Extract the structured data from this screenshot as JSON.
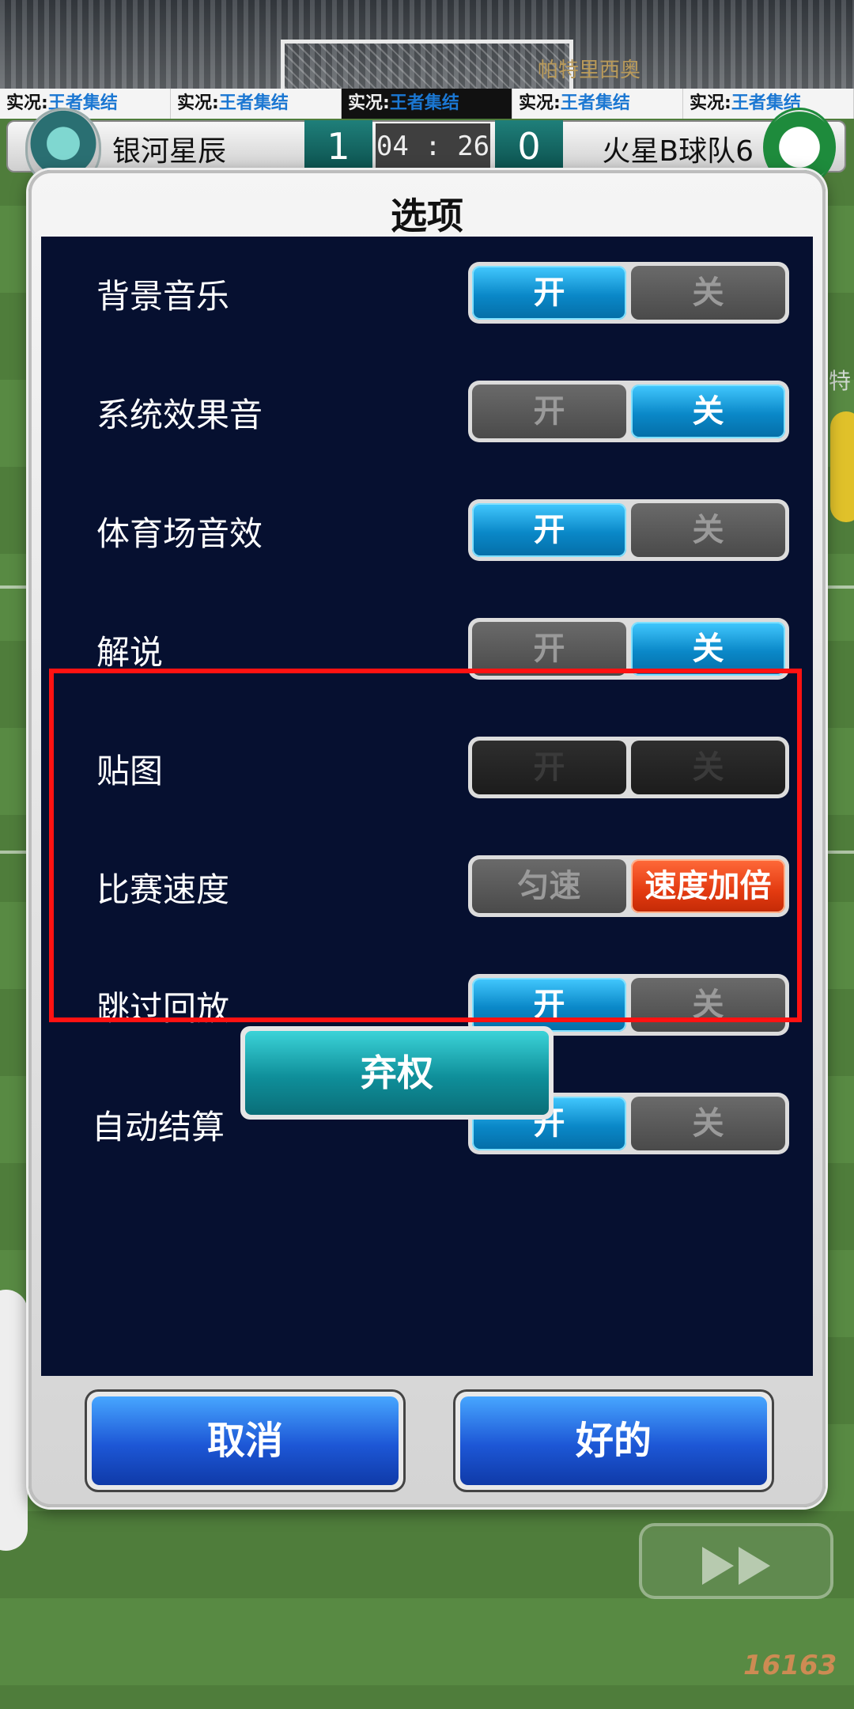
{
  "stadium": {
    "ad_prefix": "实况:",
    "ad_highlight": "王者集结",
    "stand_text": "帕特里西奥",
    "side_text": "特"
  },
  "scoreboard": {
    "home_team": "银河星辰",
    "home_score": "1",
    "clock": "04 : 26",
    "away_score": "0",
    "away_team": "火星B球队6"
  },
  "dialog": {
    "title": "选项",
    "options": [
      {
        "label": "背景音乐",
        "on_label": "开",
        "off_label": "关",
        "selected": "on"
      },
      {
        "label": "系统效果音",
        "on_label": "开",
        "off_label": "关",
        "selected": "off"
      },
      {
        "label": "体育场音效",
        "on_label": "开",
        "off_label": "关",
        "selected": "on"
      },
      {
        "label": "解说",
        "on_label": "开",
        "off_label": "关",
        "selected": "off"
      },
      {
        "label": "贴图",
        "on_label": "开",
        "off_label": "关",
        "selected": "disabled"
      },
      {
        "label": "比赛速度",
        "on_label": "匀速",
        "off_label": "速度加倍",
        "selected": "off"
      },
      {
        "label": "跳过回放",
        "on_label": "开",
        "off_label": "关",
        "selected": "on"
      },
      {
        "label": "自动结算",
        "on_label": "开",
        "off_label": "关",
        "selected": "on"
      }
    ],
    "forfeit_label": "弃权",
    "cancel_label": "取消",
    "ok_label": "好的"
  },
  "watermark": "16163",
  "colors": {
    "toggle_on": "#0a88c8",
    "toggle_off": "#4a4a4a",
    "speed_active": "#e33a10",
    "highlight_box": "#ff1212",
    "dialog_bg": "#061030"
  }
}
